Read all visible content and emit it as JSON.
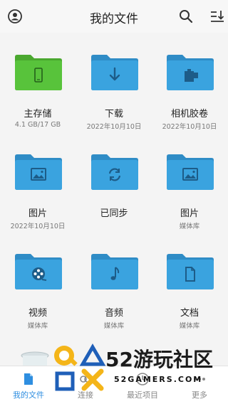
{
  "header": {
    "title": "我的文件",
    "icons": [
      "user-icon",
      "search-icon",
      "sort-icon"
    ]
  },
  "folders": [
    {
      "name": "主存储",
      "sub": "4.1 GB/17 GB",
      "icon": "phone-icon",
      "color": "#58c33b"
    },
    {
      "name": "下载",
      "sub": "2022年10月10日",
      "icon": "download-arrow-icon",
      "color": "#3aa3df"
    },
    {
      "name": "相机胶卷",
      "sub": "2022年10月10日",
      "icon": "camera-roll-icon",
      "color": "#3aa3df"
    },
    {
      "name": "图片",
      "sub": "2022年10月10日",
      "icon": "image-icon",
      "color": "#3aa3df"
    },
    {
      "name": "已同步",
      "sub": "",
      "icon": "sync-icon",
      "color": "#3aa3df"
    },
    {
      "name": "图片",
      "sub": "媒体库",
      "icon": "image-icon",
      "color": "#3aa3df"
    },
    {
      "name": "视频",
      "sub": "媒体库",
      "icon": "film-reel-icon",
      "color": "#3aa3df"
    },
    {
      "name": "音频",
      "sub": "媒体库",
      "icon": "music-note-icon",
      "color": "#3aa3df"
    },
    {
      "name": "文档",
      "sub": "媒体库",
      "icon": "document-icon",
      "color": "#3aa3df"
    }
  ],
  "bottom_tabs": [
    {
      "label": "我的文件",
      "icon": "file-icon",
      "active": true
    },
    {
      "label": "连接",
      "icon": "link-icon",
      "active": false
    },
    {
      "label": "最近项目",
      "icon": "clock-icon",
      "active": false
    },
    {
      "label": "更多",
      "icon": "more-icon",
      "active": false
    }
  ],
  "watermark": {
    "brand": "52游玩社区",
    "site": "52GAMERS.COM"
  },
  "colors": {
    "accent": "#2e8ee0",
    "folder_blue": "#3aa3df",
    "folder_green": "#58c33b"
  }
}
